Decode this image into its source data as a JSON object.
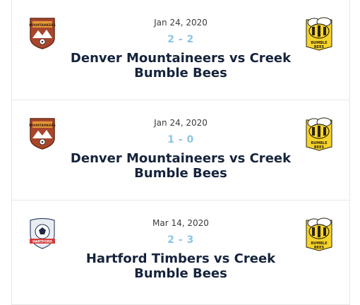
{
  "matches": [
    {
      "date": "Jan 24, 2020",
      "score": "2 - 2",
      "title": "Denver Mountaineers vs Creek Bumble Bees",
      "home_logo": "denver-mountaineers-logo",
      "away_logo": "creek-bumble-bees-logo"
    },
    {
      "date": "Jan 24, 2020",
      "score": "1 - 0",
      "title": "Denver Mountaineers vs Creek Bumble Bees",
      "home_logo": "denver-mountaineers-logo",
      "away_logo": "creek-bumble-bees-logo"
    },
    {
      "date": "Mar 14, 2020",
      "score": "2 - 3",
      "title": "Hartford Timbers vs Creek Bumble Bees",
      "home_logo": "hartford-timbers-logo",
      "away_logo": "creek-bumble-bees-logo"
    }
  ],
  "logo_text": {
    "denver": "MOUNTAINEERS",
    "bees": "BUMBLE BEES",
    "hartford": "HARTFORD"
  },
  "colors": {
    "score": "#8cc5e6",
    "title": "#15233c",
    "bee_yellow": "#f6d32a"
  }
}
